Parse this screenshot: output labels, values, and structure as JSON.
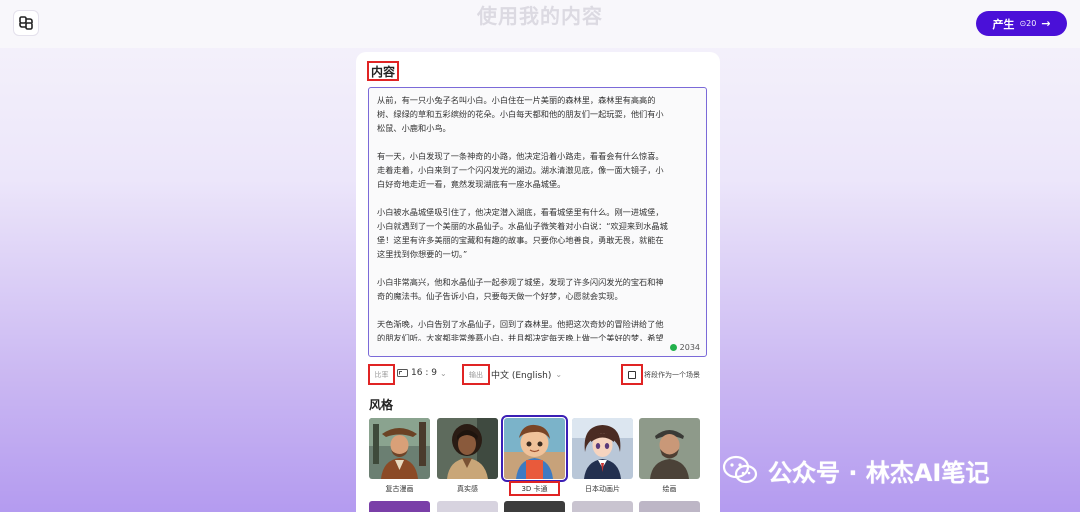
{
  "header": {
    "title": "使用我的内容",
    "generate": {
      "label": "产生",
      "credits": "20"
    }
  },
  "content": {
    "label": "内容",
    "story": "从前，有一只小兔子名叫小白。小白住在一片美丽的森林里，森林里有高高的\n树、绿绿的草和五彩缤纷的花朵。小白每天都和他的朋友们一起玩耍，他们有小\n松鼠、小鹿和小鸟。\n\n有一天，小白发现了一条神奇的小路，他决定沿着小路走，看看会有什么惊喜。\n走着走着，小白来到了一个闪闪发光的湖边。湖水清澈见底，像一面大镜子，小\n白好奇地走近一看，竟然发现湖底有一座水晶城堡。\n\n小白被水晶城堡吸引住了，他决定潜入湖底，看看城堡里有什么。刚一进城堡，\n小白就遇到了一个美丽的水晶仙子。水晶仙子微笑着对小白说：“欢迎来到水晶城\n堡！这里有许多美丽的宝藏和有趣的故事。只要你心地善良，勇敢无畏，就能在\n这里找到你想要的一切。”\n\n小白非常高兴，他和水晶仙子一起参观了城堡，发现了许多闪闪发光的宝石和神\n奇的魔法书。仙子告诉小白，只要每天做一个好梦，心愿就会实现。\n\n天色渐晚，小白告别了水晶仙子，回到了森林里。他把这次奇妙的冒险讲给了他\n的朋友们听。大家都非常羡慕小白，并且都决定每天晚上做一个美好的梦，希望\n有一天也能遇见水晶仙子。",
    "char_count": "2034"
  },
  "options": {
    "ratio_label": "比率",
    "ratio_value": "16 : 9",
    "output_label": "输出",
    "output_value": "中文 (English)",
    "scene_checkbox_label": "将段作为一个场景",
    "scene_checked": false
  },
  "styles": {
    "heading": "风格",
    "items": [
      {
        "label": "复古漫画",
        "selected": false
      },
      {
        "label": "真实感",
        "selected": false
      },
      {
        "label": "3D 卡通",
        "selected": true
      },
      {
        "label": "日本动画片",
        "selected": false
      },
      {
        "label": "绘画",
        "selected": false
      }
    ]
  },
  "watermark": {
    "text": "公众号 · 林杰AI笔记"
  }
}
